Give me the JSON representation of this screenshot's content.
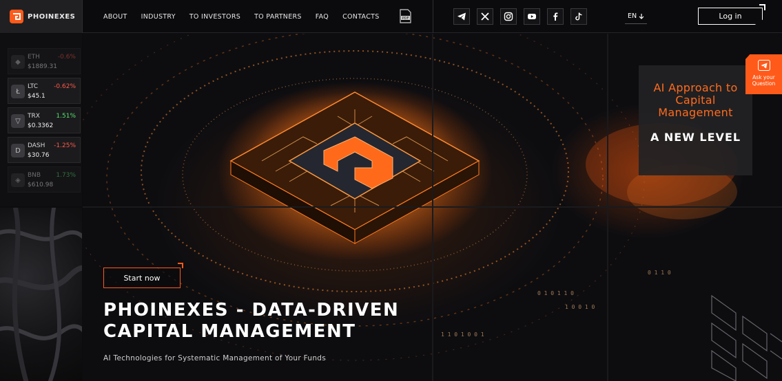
{
  "brand": {
    "name": "PHOINEXES"
  },
  "nav": [
    "ABOUT",
    "INDUSTRY",
    "TO INVESTORS",
    "TO PARTNERS",
    "FAQ",
    "CONTACTS"
  ],
  "header": {
    "pdf_label": "PDF",
    "language": "EN",
    "login_label": "Log in"
  },
  "social": [
    "telegram-icon",
    "x-icon",
    "instagram-icon",
    "youtube-icon",
    "facebook-icon",
    "tiktok-icon"
  ],
  "crypto": [
    {
      "symbol": "ETH",
      "change": "-0.6%",
      "price": "$1889.31",
      "direction": "down",
      "dim": true
    },
    {
      "symbol": "LTC",
      "change": "-0.62%",
      "price": "$45.1",
      "direction": "down",
      "dim": false
    },
    {
      "symbol": "TRX",
      "change": "1.51%",
      "price": "$0.3362",
      "direction": "up",
      "dim": false
    },
    {
      "symbol": "DASH",
      "change": "-1.25%",
      "price": "$30.76",
      "direction": "down",
      "dim": false
    },
    {
      "symbol": "BNB",
      "change": "1.73%",
      "price": "$610.98",
      "direction": "up",
      "dim": true
    }
  ],
  "promo": {
    "title": "AI Approach to Capital Management",
    "subtitle": "A NEW LEVEL"
  },
  "ask": {
    "label": "Ask your Question"
  },
  "hero": {
    "cta": "Start now",
    "headline_line1": "PHOINEXES - DATA-DRIVEN",
    "headline_line2": "CAPITAL MANAGEMENT",
    "tagline": "AI Technologies for Systematic Management of Your Funds"
  },
  "colors": {
    "accent": "#ff5a1a",
    "positive": "#58e36b",
    "negative": "#ff5a49",
    "background": "#0c0c0e"
  }
}
